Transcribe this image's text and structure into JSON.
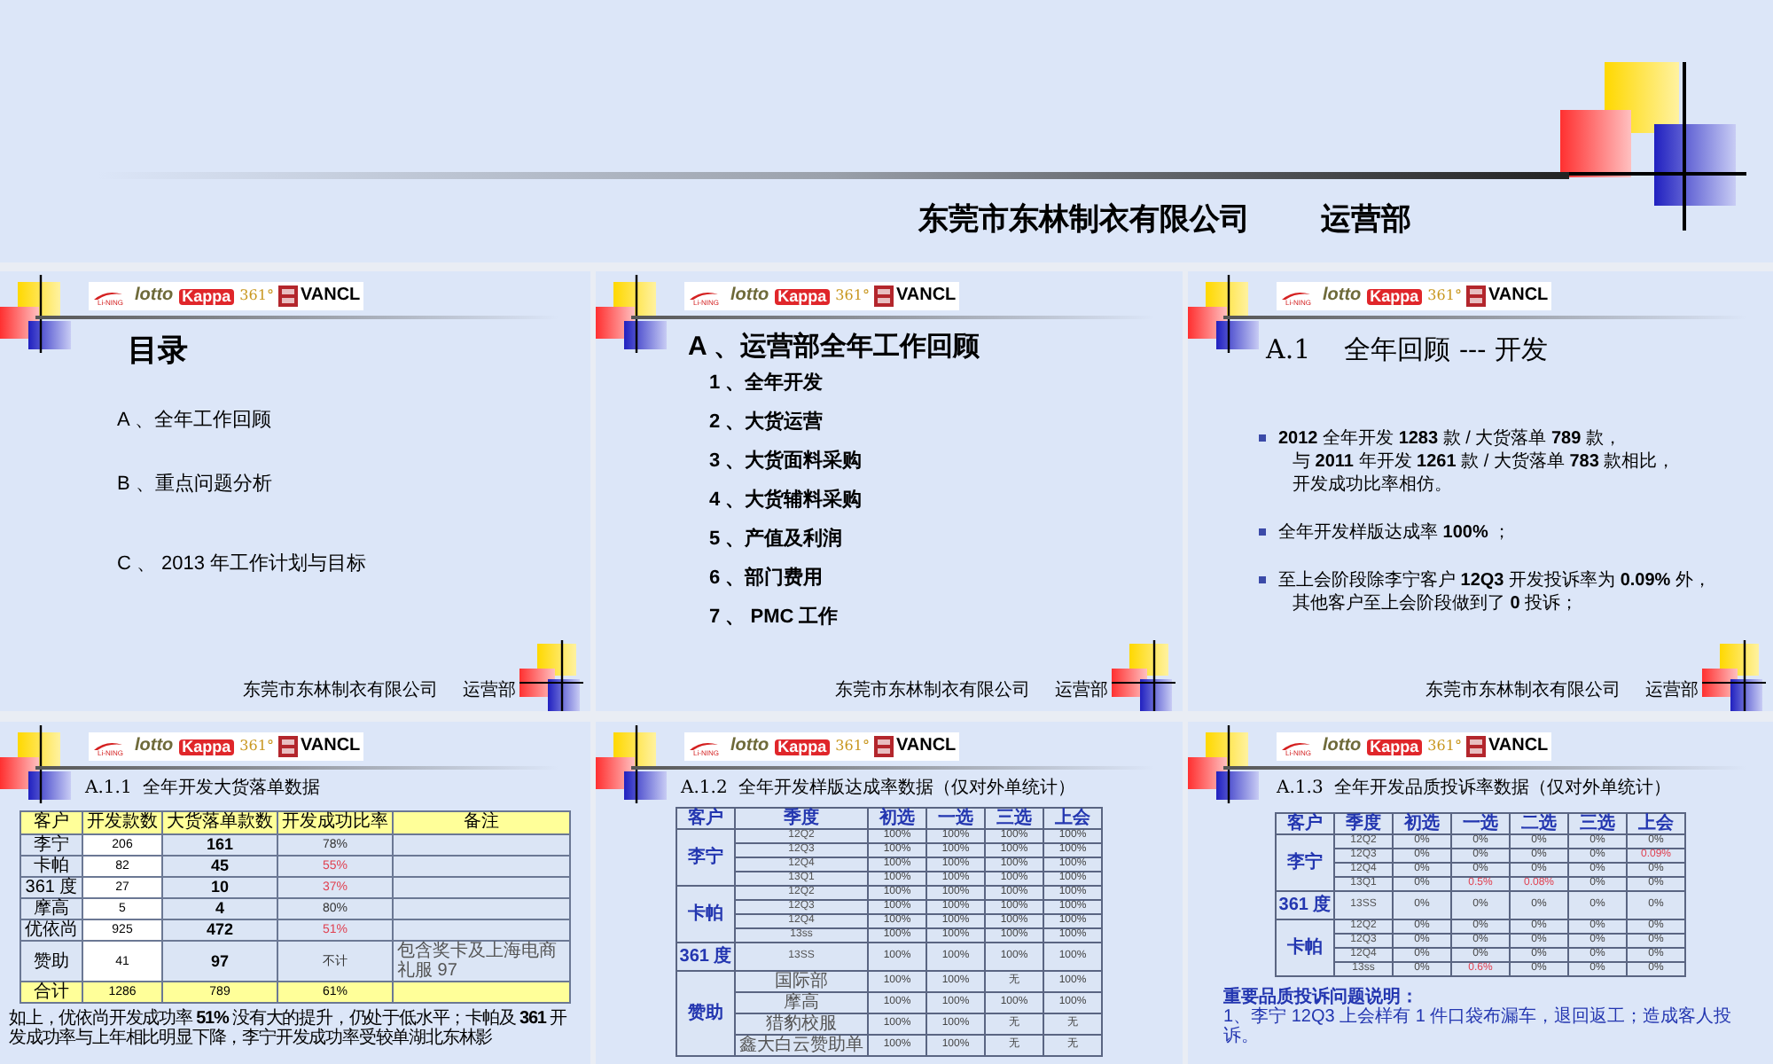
{
  "title_slide": {
    "company": "东莞市东林制衣有限公司",
    "department": "运营部"
  },
  "slides": [
    {
      "kind": "contents",
      "logos": [
        "Li-NING",
        "lotto",
        "Kappa",
        "361°",
        "VANCL"
      ],
      "title": "目录",
      "items": [
        "A 、全年工作回顾",
        "B 、重点问题分析",
        "C 、 2013 年工作计划与目标"
      ],
      "footer": {
        "company": "东莞市东林制衣有限公司",
        "department": "运营部"
      }
    },
    {
      "kind": "agenda",
      "logos": [
        "Li-NING",
        "lotto",
        "Kappa",
        "361°",
        "VANCL"
      ],
      "title": "A 、运营部全年工作回顾",
      "items": [
        "1 、全年开发",
        "2 、大货运营",
        "3 、大货面料采购",
        "4 、大货辅料采购",
        "5 、产值及利润",
        "6 、部门费用",
        "7 、 PMC 工作"
      ],
      "footer": {
        "company": "东莞市东林制衣有限公司",
        "department": "运营部"
      }
    },
    {
      "kind": "bullets",
      "logos": [
        "Li-NING",
        "lotto",
        "Kappa",
        "361°",
        "VANCL"
      ],
      "title": "A.1    全年回顾 --- 开发",
      "bullets": [
        {
          "lines": [
            "**2012** 全年开发 **1283** 款 / 大货落单 **789** 款，",
            "与 **2011** 年开发 **1261** 款 / 大货落单 **783** 款相比，",
            "开发成功比率相仿。"
          ]
        },
        {
          "lines": [
            "全年开发样版达成率 **100%** ；"
          ]
        },
        {
          "lines": [
            "至上会阶段除李宁客户 **12Q3** 开发投诉率为 **0.09%** 外，",
            "其他客户至上会阶段做到了 **0** 投诉；"
          ]
        }
      ],
      "footer": {
        "company": "东莞市东林制衣有限公司",
        "department": "运营部"
      }
    },
    {
      "kind": "orders_table",
      "logos": [
        "Li-NING",
        "lotto",
        "Kappa",
        "361°",
        "VANCL"
      ],
      "title": "A.1.1  全年开发大货落单数据",
      "columns": [
        "客户",
        "开发款数",
        "大货落单款数",
        "开发成功比率",
        "备注"
      ],
      "rows": [
        {
          "customer": "李宁",
          "developed": "206",
          "orders": "161",
          "rate": "78%",
          "alert": false,
          "note": ""
        },
        {
          "customer": "卡帕",
          "developed": "82",
          "orders": "45",
          "rate": "55%",
          "alert": true,
          "note": ""
        },
        {
          "customer": "361 度",
          "developed": "27",
          "orders": "10",
          "rate": "37%",
          "alert": true,
          "note": ""
        },
        {
          "customer": "摩高",
          "developed": "5",
          "orders": "4",
          "rate": "80%",
          "alert": false,
          "note": ""
        },
        {
          "customer": "优依尚",
          "developed": "925",
          "orders": "472",
          "rate": "51%",
          "alert": true,
          "note": ""
        },
        {
          "customer": "赞助",
          "developed": "41",
          "orders": "97",
          "rate": "不计",
          "alert": false,
          "note": "包含奖卡及上海电商礼服 97"
        }
      ],
      "total": {
        "customer": "合计",
        "developed": "1286",
        "orders": "789",
        "rate": "61%"
      },
      "summary": "如上，优依尚开发成功率 **51%** 没有大的提升，仍处于低水平；卡帕及 **361** 开发成功率与上年相比明显下降，李宁开发成功率受较单湖北东林影"
    },
    {
      "kind": "pass_table",
      "logos": [
        "Li-NING",
        "lotto",
        "Kappa",
        "361°",
        "VANCL"
      ],
      "title": "A.1.2  全年开发样版达成率数据（仅对外单统计）",
      "columns": [
        "客户",
        "季度",
        "初选",
        "一选",
        "三选",
        "上会"
      ],
      "groups": [
        {
          "customer": "李宁",
          "rows": [
            {
              "season": "12Q2",
              "cells": [
                "100%",
                "100%",
                "100%",
                "100%"
              ]
            },
            {
              "season": "12Q3",
              "cells": [
                "100%",
                "100%",
                "100%",
                "100%"
              ]
            },
            {
              "season": "12Q4",
              "cells": [
                "100%",
                "100%",
                "100%",
                "100%"
              ]
            },
            {
              "season": "13Q1",
              "cells": [
                "100%",
                "100%",
                "100%",
                "100%"
              ]
            }
          ]
        },
        {
          "customer": "卡帕",
          "rows": [
            {
              "season": "12Q2",
              "cells": [
                "100%",
                "100%",
                "100%",
                "100%"
              ]
            },
            {
              "season": "12Q3",
              "cells": [
                "100%",
                "100%",
                "100%",
                "100%"
              ]
            },
            {
              "season": "12Q4",
              "cells": [
                "100%",
                "100%",
                "100%",
                "100%"
              ]
            },
            {
              "season": "13ss",
              "cells": [
                "100%",
                "100%",
                "100%",
                "100%"
              ]
            }
          ]
        },
        {
          "customer": "361 度",
          "rows": [
            {
              "season": "13SS",
              "cells": [
                "100%",
                "100%",
                "100%",
                "100%"
              ]
            }
          ]
        },
        {
          "customer": "赞助",
          "rows": [
            {
              "season": "国际部",
              "cells": [
                "100%",
                "100%",
                "无",
                "100%"
              ]
            },
            {
              "season": "摩高",
              "cells": [
                "100%",
                "100%",
                "100%",
                "100%"
              ]
            },
            {
              "season": "猎豹校服",
              "cells": [
                "100%",
                "100%",
                "无",
                "无"
              ]
            },
            {
              "season": "鑫大白云赞助单",
              "cells": [
                "100%",
                "100%",
                "无",
                "无"
              ]
            }
          ]
        }
      ]
    },
    {
      "kind": "complaint_table",
      "logos": [
        "Li-NING",
        "lotto",
        "Kappa",
        "361°",
        "VANCL"
      ],
      "title": "A.1.3  全年开发品质投诉率数据（仅对外单统计）",
      "columns": [
        "客户",
        "季度",
        "初选",
        "一选",
        "二选",
        "三选",
        "上会"
      ],
      "groups": [
        {
          "customer": "李宁",
          "rows": [
            {
              "season": "12Q2",
              "cells": [
                {
                  "text": "0%",
                  "alert": false
                },
                {
                  "text": "0%",
                  "alert": false
                },
                {
                  "text": "0%",
                  "alert": false
                },
                {
                  "text": "0%",
                  "alert": false
                },
                {
                  "text": "0%",
                  "alert": false
                }
              ]
            },
            {
              "season": "12Q3",
              "cells": [
                {
                  "text": "0%",
                  "alert": false
                },
                {
                  "text": "0%",
                  "alert": false
                },
                {
                  "text": "0%",
                  "alert": false
                },
                {
                  "text": "0%",
                  "alert": false
                },
                {
                  "text": "0.09%",
                  "alert": true
                }
              ]
            },
            {
              "season": "12Q4",
              "cells": [
                {
                  "text": "0%",
                  "alert": false
                },
                {
                  "text": "0%",
                  "alert": false
                },
                {
                  "text": "0%",
                  "alert": false
                },
                {
                  "text": "0%",
                  "alert": false
                },
                {
                  "text": "0%",
                  "alert": false
                }
              ]
            },
            {
              "season": "13Q1",
              "cells": [
                {
                  "text": "0%",
                  "alert": false
                },
                {
                  "text": "0.5%",
                  "alert": true
                },
                {
                  "text": "0.08%",
                  "alert": true
                },
                {
                  "text": "0%",
                  "alert": false
                },
                {
                  "text": "0%",
                  "alert": false
                }
              ]
            }
          ]
        },
        {
          "customer": "361 度",
          "rows": [
            {
              "season": "13SS",
              "cells": [
                {
                  "text": "0%",
                  "alert": false
                },
                {
                  "text": "0%",
                  "alert": false
                },
                {
                  "text": "0%",
                  "alert": false
                },
                {
                  "text": "0%",
                  "alert": false
                },
                {
                  "text": "0%",
                  "alert": false
                }
              ]
            }
          ]
        },
        {
          "customer": "卡帕",
          "rows": [
            {
              "season": "12Q2",
              "cells": [
                {
                  "text": "0%",
                  "alert": false
                },
                {
                  "text": "0%",
                  "alert": false
                },
                {
                  "text": "0%",
                  "alert": false
                },
                {
                  "text": "0%",
                  "alert": false
                },
                {
                  "text": "0%",
                  "alert": false
                }
              ]
            },
            {
              "season": "12Q3",
              "cells": [
                {
                  "text": "0%",
                  "alert": false
                },
                {
                  "text": "0%",
                  "alert": false
                },
                {
                  "text": "0%",
                  "alert": false
                },
                {
                  "text": "0%",
                  "alert": false
                },
                {
                  "text": "0%",
                  "alert": false
                }
              ]
            },
            {
              "season": "12Q4",
              "cells": [
                {
                  "text": "0%",
                  "alert": false
                },
                {
                  "text": "0%",
                  "alert": false
                },
                {
                  "text": "0%",
                  "alert": false
                },
                {
                  "text": "0%",
                  "alert": false
                },
                {
                  "text": "0%",
                  "alert": false
                }
              ]
            },
            {
              "season": "13ss",
              "cells": [
                {
                  "text": "0%",
                  "alert": false
                },
                {
                  "text": "0.6%",
                  "alert": true
                },
                {
                  "text": "0%",
                  "alert": false
                },
                {
                  "text": "0%",
                  "alert": false
                },
                {
                  "text": "0%",
                  "alert": false
                }
              ]
            }
          ]
        }
      ],
      "notes_title": "重要品质投诉问题说明：",
      "notes": [
        "1、李宁 12Q3 上会样有 1 件口袋布漏车，退回返工；造成客人投诉。"
      ]
    }
  ]
}
